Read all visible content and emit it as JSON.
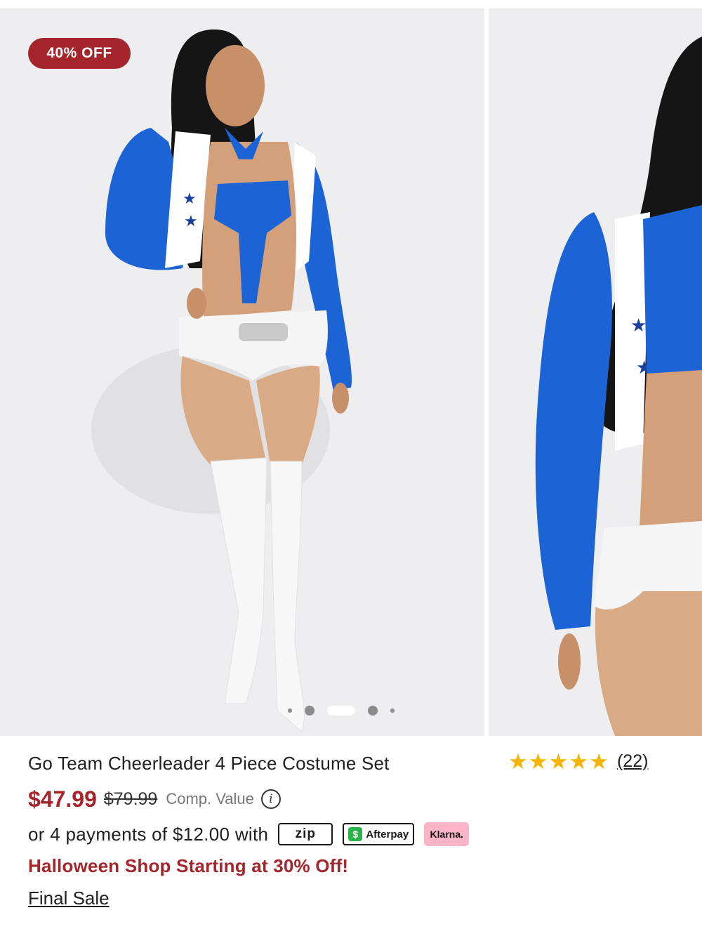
{
  "gallery": {
    "badge": "40% OFF",
    "images": [
      "product-photo-front",
      "product-photo-side"
    ],
    "page_count": 5,
    "active_index": 2,
    "icons": {
      "share": "share-icon"
    }
  },
  "product": {
    "title": "Go Team Cheerleader 4 Piece Costume Set",
    "rating": 5,
    "review_count": "(22)",
    "price": "$47.99",
    "original_price": "$79.99",
    "comp_label": "Comp. Value",
    "info_icon_glyph": "i",
    "installments_text": "or 4 payments of $12.00 with",
    "payment_providers": {
      "zip": "zip",
      "afterpay": "Afterpay",
      "klarna": "Klarna."
    },
    "promo": "Halloween Shop Starting at 30% Off!",
    "final_sale": "Final Sale"
  },
  "colors": {
    "accent": "#a4262c",
    "star": "#f4b400",
    "background": "#eeeef0",
    "royal_blue": "#1c63d6"
  }
}
